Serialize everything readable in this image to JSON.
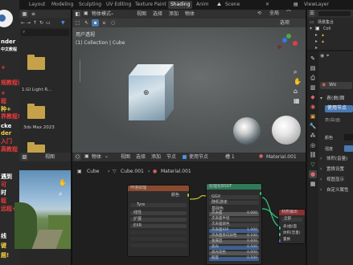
{
  "topbar": {
    "tabs": [
      "Layout",
      "Modeling",
      "Sculpting",
      "UV Editing",
      "Texture Paint",
      "Shading",
      "Anim"
    ],
    "active_tab": "Shading",
    "scene": "Scene",
    "view_layer": "ViewLayer"
  },
  "overlay_text": {
    "lines": [
      "nder",
      "中文教程",
      "+",
      "规教程计+",
      "+",
      "程",
      "种+",
      "界教程!",
      "cke",
      "der",
      "入门",
      "高教程",
      "遇到",
      "可",
      "时",
      "程",
      "远程+",
      "线",
      "键",
      "题!"
    ]
  },
  "file_browser": {
    "items": [
      "1.GI Light R...",
      "3ds Max 2023",
      ""
    ]
  },
  "image_editor": {
    "view_label": "视图"
  },
  "viewport": {
    "mode": "物体模式",
    "menu": [
      "视图",
      "选择",
      "添加",
      "物体"
    ],
    "perspective_label": "用户透视",
    "collection_label": "(1) Collection | Cube",
    "global_label": "全局",
    "options_label": "选项"
  },
  "node_editor": {
    "menu_left": [
      "物体",
      "视图",
      "选择",
      "添加",
      "节点"
    ],
    "use_nodes_label": "使用节点",
    "slot_label": "槽 1",
    "material_name": "Material.001",
    "breadcrumb": [
      "Cube",
      "Cube.001",
      "Material.001"
    ],
    "nodes": {
      "texture": {
        "title": "环境纹理",
        "rows": [
          "颜色",
          "Tyre",
          "线性",
          "扩展",
          "EXR"
        ]
      },
      "bsdf": {
        "title": "原理化BSDF",
        "fields": [
          "GGX",
          "随机游走",
          "基础色",
          "次表面",
          "次表面半径",
          "次表面颜色",
          "次表面IOR",
          "次表面各向异性",
          "金属度",
          "高光",
          "高光染色",
          "糙度"
        ],
        "values": [
          "0.000",
          "1.000",
          "0.100",
          "0.000",
          "0.500",
          "0.000",
          "0.500",
          "0.000"
        ]
      },
      "output": {
        "title": "材质输出",
        "rows": [
          "全部",
          "表(曲)面",
          "体积(音量)",
          "置换"
        ]
      }
    }
  },
  "outliner": {
    "items": [
      "场景集合",
      "Coll",
      "",
      "",
      ""
    ]
  },
  "properties": {
    "search_label": "Wo",
    "section_surface": "表(曲)面",
    "use_nodes_label": "使用节点",
    "surface_label": "表(曲)面",
    "color_label": "颜色",
    "strength_label": "强度",
    "sections": [
      "体积(音量)",
      "置换设置",
      "视图显示",
      "自定义属性"
    ]
  }
}
